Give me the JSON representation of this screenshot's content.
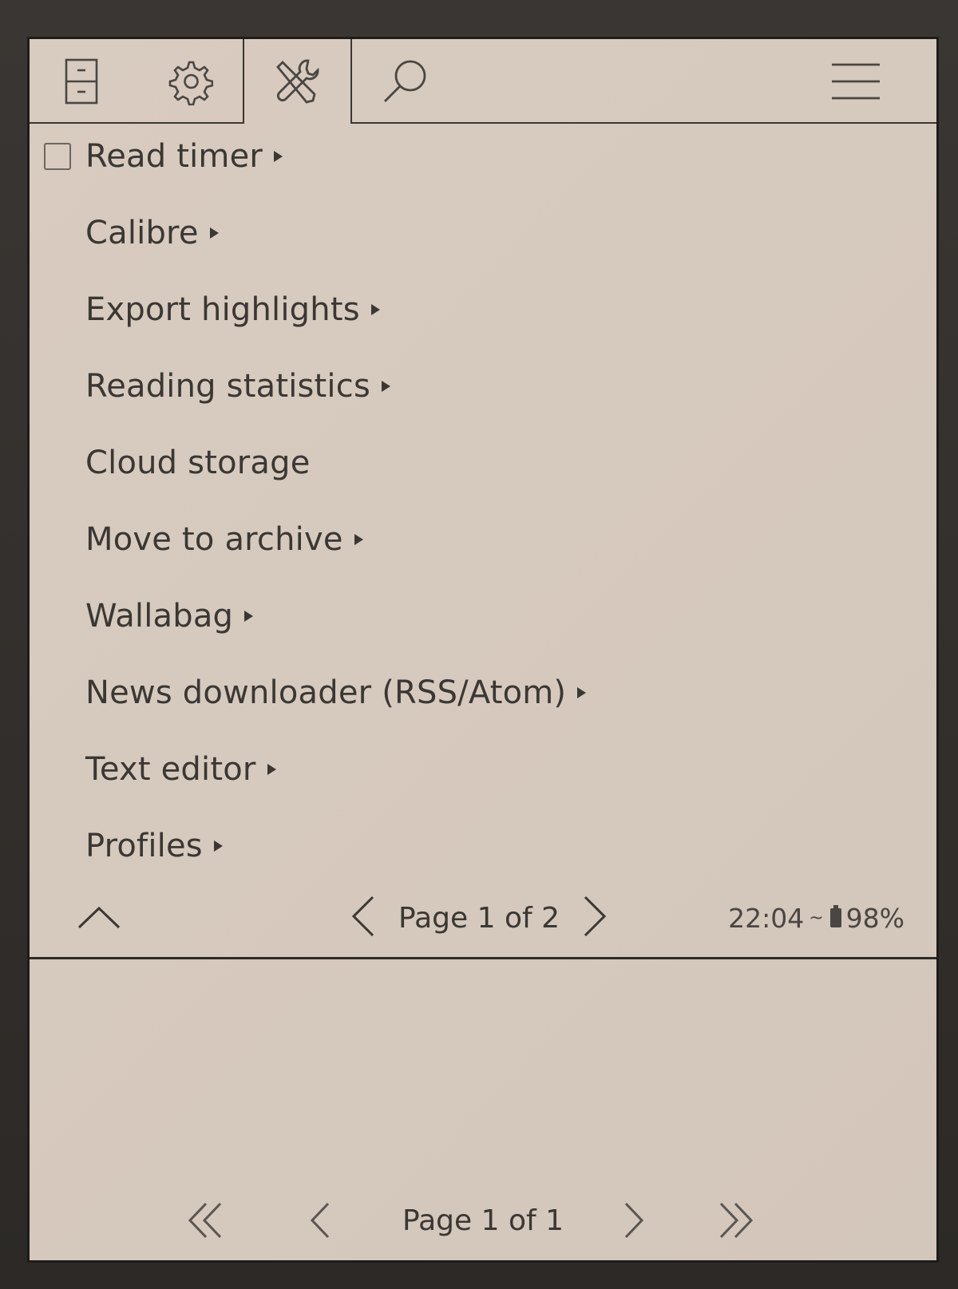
{
  "tabs": [
    {
      "icon": "file-cabinet-icon"
    },
    {
      "icon": "gear-icon"
    },
    {
      "icon": "tools-icon",
      "active": true
    },
    {
      "icon": "search-icon"
    },
    {
      "icon": "hamburger-menu-icon"
    }
  ],
  "menu": {
    "items": [
      {
        "label": "Read timer",
        "has_submenu": true,
        "checkbox": true,
        "checked": false
      },
      {
        "label": "Calibre",
        "has_submenu": true
      },
      {
        "label": "Export highlights",
        "has_submenu": true
      },
      {
        "label": "Reading statistics",
        "has_submenu": true
      },
      {
        "label": "Cloud storage",
        "has_submenu": false
      },
      {
        "label": "Move to archive",
        "has_submenu": true
      },
      {
        "label": "Wallabag",
        "has_submenu": true
      },
      {
        "label": "News downloader (RSS/Atom)",
        "has_submenu": true
      },
      {
        "label": "Text editor",
        "has_submenu": true
      },
      {
        "label": "Profiles",
        "has_submenu": true
      }
    ],
    "page_text": "Page 1 of 2",
    "status": {
      "time": "22:04",
      "separator": "~",
      "battery": "98%"
    }
  },
  "bottom": {
    "page_text": "Page 1 of 1"
  },
  "colors": {
    "screen": "#d6c9bd",
    "ink": "#3a3734",
    "bezel": "#2e2b28"
  }
}
